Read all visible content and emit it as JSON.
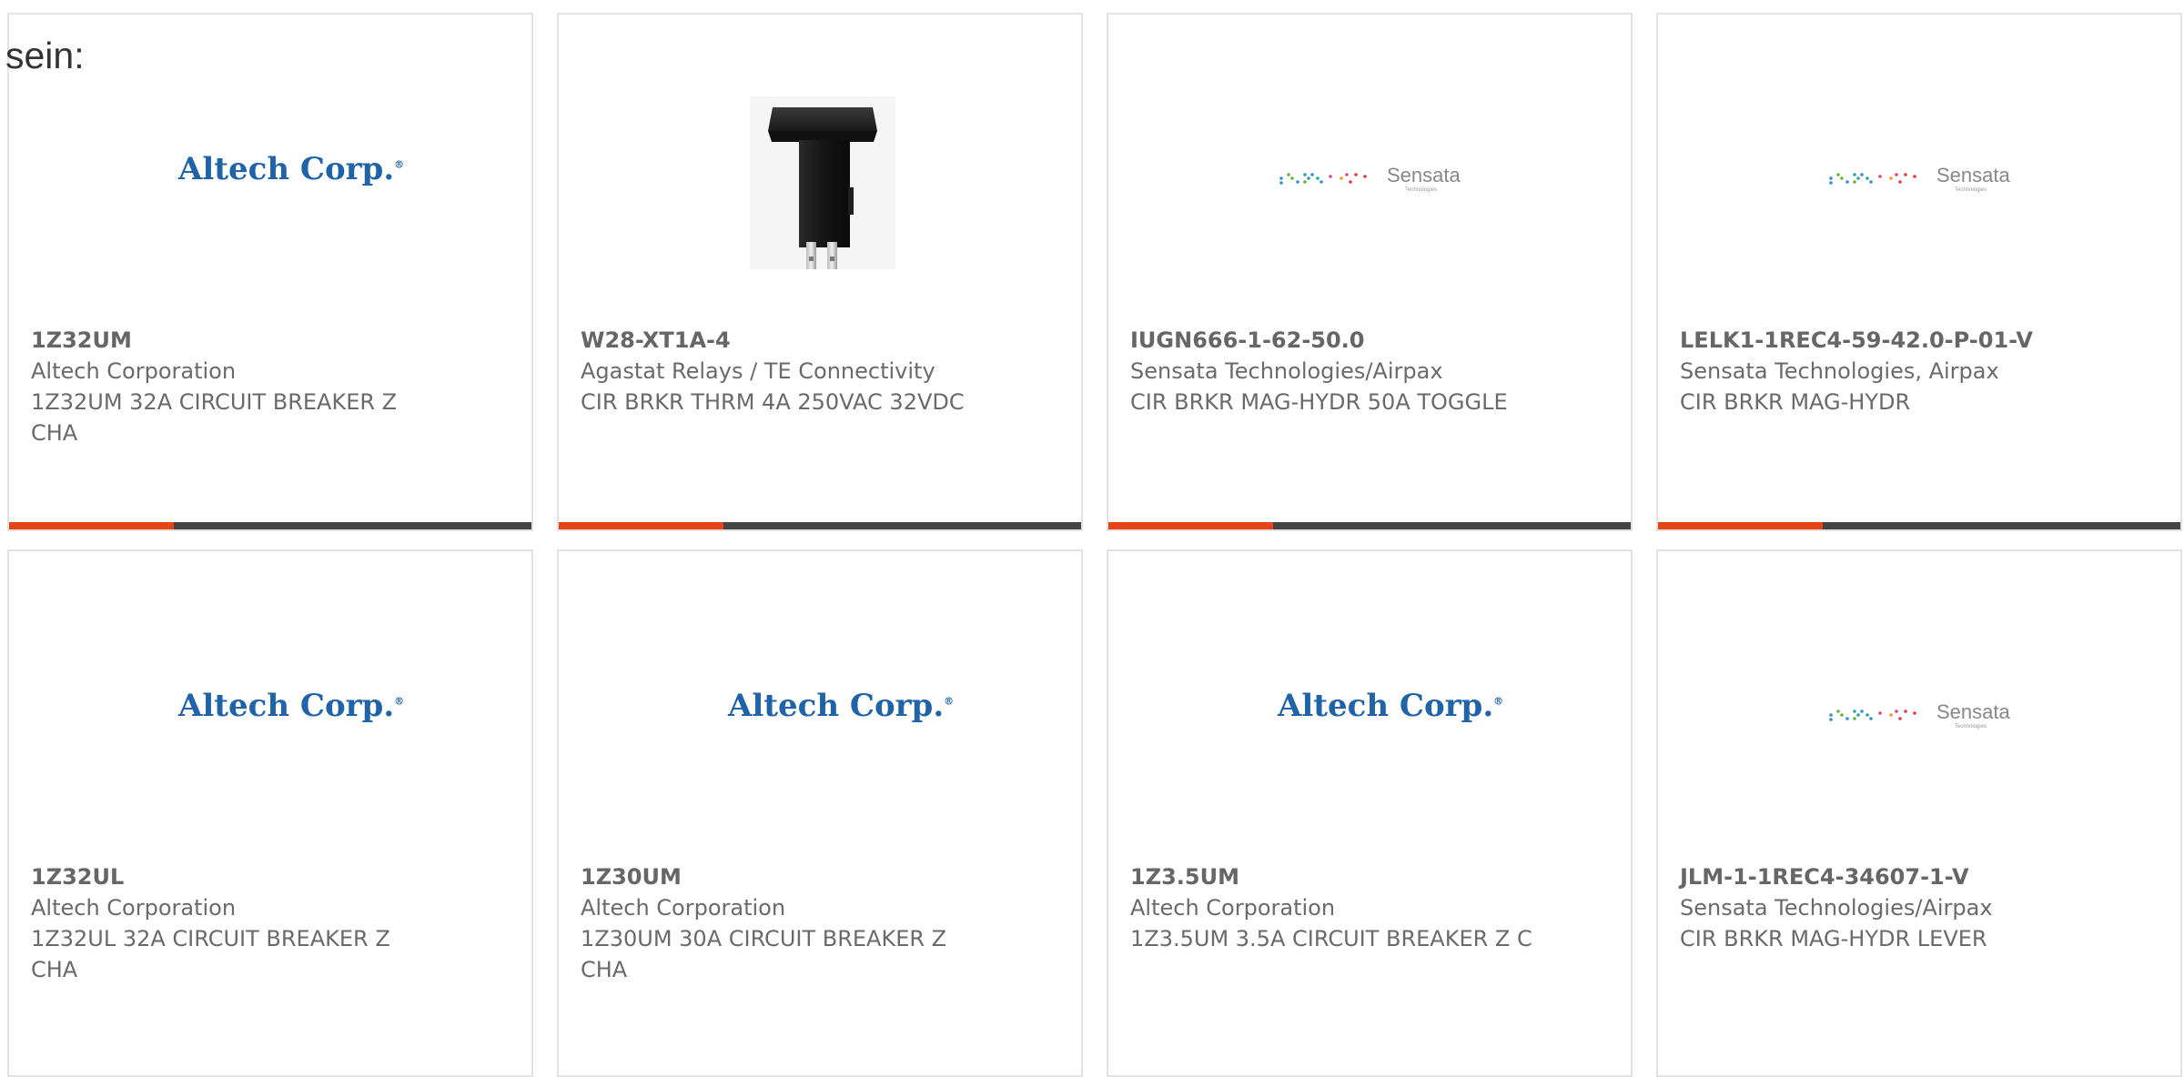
{
  "page": {
    "label": "sein:"
  },
  "colors": {
    "accent": "#e64415",
    "bar": "#444444",
    "altech_blue": "#1f63a8",
    "card_border": "#e2e2e2",
    "text": "#666666"
  },
  "cards": [
    {
      "logo": "altech-logo",
      "logo_text": "Altech Corp.",
      "part_number": "1Z32UM",
      "manufacturer": "Altech Corporation",
      "description": "1Z32UM 32A CIRCUIT BREAKER Z CHA"
    },
    {
      "logo": "breaker-product-image",
      "part_number": "W28-XT1A-4",
      "manufacturer": "Agastat Relays / TE Connectivity",
      "description": "CIR BRKR THRM 4A 250VAC 32VDC"
    },
    {
      "logo": "sensata-logo",
      "logo_text": "Sensata",
      "logo_subtext": "Technologies",
      "part_number": "IUGN666-1-62-50.0",
      "manufacturer": "Sensata Technologies/Airpax",
      "description": "CIR BRKR MAG-HYDR 50A TOGGLE"
    },
    {
      "logo": "sensata-logo",
      "logo_text": "Sensata",
      "logo_subtext": "Technologies",
      "part_number": "LELK1-1REC4-59-42.0-P-01-V",
      "manufacturer": "Sensata Technologies, Airpax",
      "description": "CIR BRKR MAG-HYDR"
    },
    {
      "logo": "altech-logo",
      "logo_text": "Altech Corp.",
      "part_number": "1Z32UL",
      "manufacturer": "Altech Corporation",
      "description": "1Z32UL 32A CIRCUIT BREAKER Z CHA"
    },
    {
      "logo": "altech-logo",
      "logo_text": "Altech Corp.",
      "part_number": "1Z30UM",
      "manufacturer": "Altech Corporation",
      "description": "1Z30UM 30A CIRCUIT BREAKER Z CHA"
    },
    {
      "logo": "altech-logo",
      "logo_text": "Altech Corp.",
      "part_number": "1Z3.5UM",
      "manufacturer": "Altech Corporation",
      "description": "1Z3.5UM 3.5A CIRCUIT BREAKER Z C"
    },
    {
      "logo": "sensata-logo",
      "logo_text": "Sensata",
      "logo_subtext": "Technologies",
      "part_number": "JLM-1-1REC4-34607-1-V",
      "manufacturer": "Sensata Technologies/Airpax",
      "description": "CIR BRKR MAG-HYDR LEVER"
    }
  ]
}
